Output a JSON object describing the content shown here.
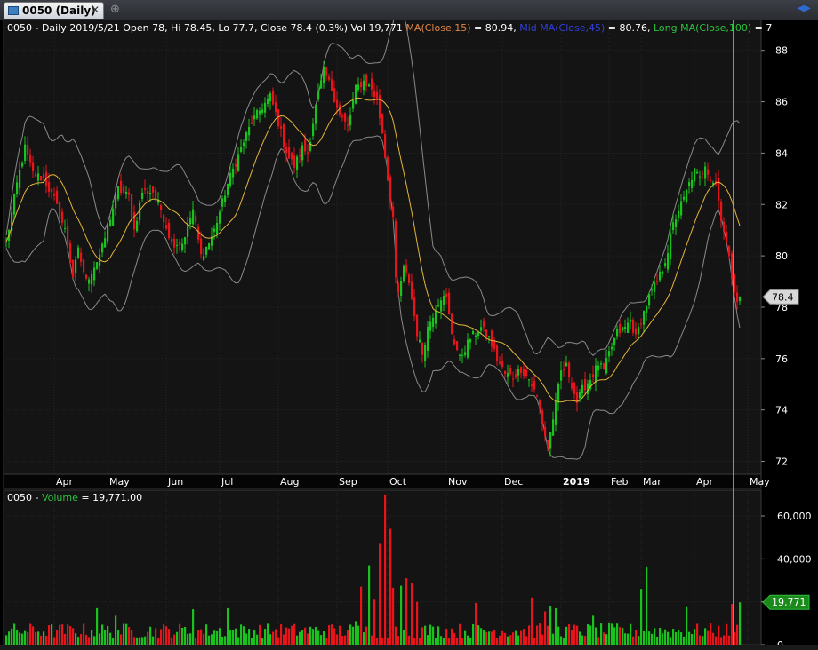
{
  "tab": {
    "label": "0050 (Daily)",
    "close": "✕",
    "new_tab": "⊕",
    "nav": "◀▶"
  },
  "header": {
    "symbol": "0050",
    "info": " - Daily 2019/5/21 Open 78, Hi 78.45, Lo 77.7, Close 78.4 (0.3%) Vol 19,771 ",
    "ma1_label": "MA(Close,15)",
    "ma1_value": " = 80.94, ",
    "ma2_label": "Mid MA(Close,45)",
    "ma2_value": " = 80.76, ",
    "ma3_label": "Long MA(Close,100)",
    "ma3_value": " = 7"
  },
  "volume_header": {
    "symbol": "0050",
    "sep": " - ",
    "label": "Volume",
    "value": " = 19,771.00"
  },
  "colors": {
    "up": "#19c21c",
    "down": "#e8141b",
    "ma": "#e5b53b",
    "band": "#8a8a8a",
    "ma1_text": "#e08848",
    "ma2_text": "#3040d8",
    "ma3_text": "#2ec040",
    "cursor": "#9aa0ff"
  },
  "chart_data": [
    {
      "type": "candlestick",
      "series_label": "0050",
      "ylim": [
        71.5,
        89.2
      ],
      "y_ticks": [
        72,
        74,
        76,
        78,
        80,
        82,
        84,
        86,
        88
      ],
      "x_labels": [
        {
          "label": "Apr",
          "index": 18
        },
        {
          "label": "May",
          "index": 38
        },
        {
          "label": "Jun",
          "index": 60
        },
        {
          "label": "Jul",
          "index": 80
        },
        {
          "label": "Aug",
          "index": 102
        },
        {
          "label": "Sep",
          "index": 124
        },
        {
          "label": "Oct",
          "index": 143
        },
        {
          "label": "Nov",
          "index": 165
        },
        {
          "label": "Dec",
          "index": 186
        },
        {
          "label": "2019",
          "index": 208
        },
        {
          "label": "Feb",
          "index": 226
        },
        {
          "label": "Mar",
          "index": 238
        },
        {
          "label": "Apr",
          "index": 258
        },
        {
          "label": "May",
          "index": 278
        }
      ],
      "last_close": {
        "value": 78.4,
        "label": "78.4"
      },
      "anchors": [
        [
          0,
          80.5
        ],
        [
          4,
          82.8
        ],
        [
          7,
          84.2
        ],
        [
          10,
          83.2
        ],
        [
          14,
          83.0
        ],
        [
          18,
          82.2
        ],
        [
          22,
          81.0
        ],
        [
          25,
          79.2
        ],
        [
          27,
          80.2
        ],
        [
          30,
          79.0
        ],
        [
          34,
          79.8
        ],
        [
          36,
          80.3
        ],
        [
          39,
          81.5
        ],
        [
          42,
          82.6
        ],
        [
          46,
          82.3
        ],
        [
          48,
          81.0
        ],
        [
          51,
          82.5
        ],
        [
          55,
          82.5
        ],
        [
          58,
          81.8
        ],
        [
          62,
          80.5
        ],
        [
          66,
          80.5
        ],
        [
          70,
          81.8
        ],
        [
          73,
          80.0
        ],
        [
          76,
          80.5
        ],
        [
          78,
          81.0
        ],
        [
          83,
          82.8
        ],
        [
          88,
          84.2
        ],
        [
          92,
          85.2
        ],
        [
          96,
          85.8
        ],
        [
          99,
          86.2
        ],
        [
          102,
          85.2
        ],
        [
          104,
          84.4
        ],
        [
          106,
          83.8
        ],
        [
          108,
          83.5
        ],
        [
          111,
          84.2
        ],
        [
          113,
          84.0
        ],
        [
          116,
          85.8
        ],
        [
          119,
          87.2
        ],
        [
          122,
          86.5
        ],
        [
          125,
          85.5
        ],
        [
          128,
          85.0
        ],
        [
          131,
          86.5
        ],
        [
          134,
          86.8
        ],
        [
          137,
          86.5
        ],
        [
          139,
          86.0
        ],
        [
          141,
          84.8
        ],
        [
          143,
          83.0
        ],
        [
          145,
          81.5
        ],
        [
          146,
          79.0
        ],
        [
          147,
          78.5
        ],
        [
          149,
          79.5
        ],
        [
          151,
          79.0
        ],
        [
          154,
          77.0
        ],
        [
          156,
          76.2
        ],
        [
          158,
          77.2
        ],
        [
          161,
          78.0
        ],
        [
          163,
          78.4
        ],
        [
          165,
          78.3
        ],
        [
          167,
          77.0
        ],
        [
          170,
          76.0
        ],
        [
          174,
          76.8
        ],
        [
          178,
          77.2
        ],
        [
          181,
          76.8
        ],
        [
          184,
          76.0
        ],
        [
          187,
          75.4
        ],
        [
          190,
          75.3
        ],
        [
          193,
          75.6
        ],
        [
          196,
          75.2
        ],
        [
          199,
          74.5
        ],
        [
          201,
          73.5
        ],
        [
          203,
          72.5
        ],
        [
          205,
          73.7
        ],
        [
          206,
          74.2
        ],
        [
          208,
          75.5
        ],
        [
          210,
          75.7
        ],
        [
          212,
          75.0
        ],
        [
          214,
          74.3
        ],
        [
          216,
          74.8
        ],
        [
          219,
          75.2
        ],
        [
          222,
          75.8
        ],
        [
          224,
          75.5
        ],
        [
          226,
          76.2
        ],
        [
          229,
          77.0
        ],
        [
          232,
          77.2
        ],
        [
          234,
          77.5
        ],
        [
          236,
          76.8
        ],
        [
          238,
          77.5
        ],
        [
          241,
          78.4
        ],
        [
          244,
          79.0
        ],
        [
          246,
          79.5
        ],
        [
          248,
          80.2
        ],
        [
          250,
          81.2
        ],
        [
          252,
          81.8
        ],
        [
          254,
          82.2
        ],
        [
          256,
          82.8
        ],
        [
          258,
          83.3
        ],
        [
          260,
          83.0
        ],
        [
          262,
          83.6
        ],
        [
          264,
          83.0
        ],
        [
          266,
          82.8
        ],
        [
          268,
          81.5
        ],
        [
          270,
          80.5
        ],
        [
          272,
          79.2
        ],
        [
          274,
          78.3
        ],
        [
          275,
          78.4
        ]
      ]
    },
    {
      "type": "bar",
      "series_label": "Volume",
      "ylim": [
        0,
        72000
      ],
      "y_ticks": [
        0,
        20000,
        40000,
        60000
      ],
      "y_tick_labels": [
        "0",
        "",
        "40,000",
        "60,000"
      ],
      "last": {
        "value": 19771,
        "label": "19,771"
      },
      "spikes": [
        {
          "index": 34,
          "value": 17000
        },
        {
          "index": 41,
          "value": 13500
        },
        {
          "index": 70,
          "value": 16500
        },
        {
          "index": 83,
          "value": 17000
        },
        {
          "index": 131,
          "value": 11000
        },
        {
          "index": 133,
          "value": 27000
        },
        {
          "index": 136,
          "value": 37000
        },
        {
          "index": 138,
          "value": 21000
        },
        {
          "index": 140,
          "value": 47000
        },
        {
          "index": 142,
          "value": 70000
        },
        {
          "index": 144,
          "value": 54000
        },
        {
          "index": 145,
          "value": 26500
        },
        {
          "index": 148,
          "value": 27500
        },
        {
          "index": 150,
          "value": 31000
        },
        {
          "index": 152,
          "value": 29000
        },
        {
          "index": 154,
          "value": 20000
        },
        {
          "index": 176,
          "value": 19500
        },
        {
          "index": 197,
          "value": 22000
        },
        {
          "index": 202,
          "value": 15500
        },
        {
          "index": 204,
          "value": 18000
        },
        {
          "index": 206,
          "value": 17000
        },
        {
          "index": 220,
          "value": 13500
        },
        {
          "index": 238,
          "value": 26000
        },
        {
          "index": 240,
          "value": 36500
        },
        {
          "index": 255,
          "value": 17500
        },
        {
          "index": 272,
          "value": 19000
        },
        {
          "index": 275,
          "value": 21000
        }
      ]
    }
  ]
}
